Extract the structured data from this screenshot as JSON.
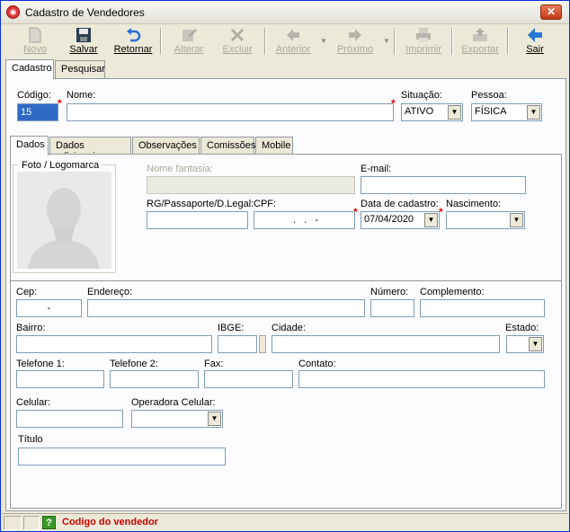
{
  "window": {
    "title": "Cadastro de Vendedores",
    "close_glyph": "✕"
  },
  "toolbar": {
    "novo": "Novo",
    "salvar": "Salvar",
    "retornar": "Retornar",
    "alterar": "Alterar",
    "excluir": "Excluir",
    "anterior": "Anterior",
    "proximo": "Próximo",
    "imprimir": "Imprimir",
    "exportar": "Exportar",
    "sair": "Sair"
  },
  "main_tabs": [
    "Cadastro",
    "Pesquisar"
  ],
  "header": {
    "codigo_label": "Código:",
    "codigo_value": "15",
    "nome_label": "Nome:",
    "nome_value": "",
    "situacao_label": "Situação:",
    "situacao_value": "ATIVO",
    "pessoa_label": "Pessoa:",
    "pessoa_value": "FÍSICA"
  },
  "sub_tabs": [
    "Dados",
    "Dados adicionais",
    "Observações",
    "Comissões",
    "Mobile"
  ],
  "dados": {
    "foto_label": "Foto / Logomarca",
    "nome_fantasia_label": "Nome fantasia:",
    "email_label": "E-mail:",
    "rg_label": "RG/Passaporte/D.Legal:",
    "cpf_label": "CPF:",
    "cpf_value": " .   .   -",
    "data_cadastro_label": "Data de cadastro:",
    "data_cadastro_value": "07/04/2020",
    "nascimento_label": "Nascimento:"
  },
  "endereco": {
    "cep_label": "Cep:",
    "cep_value": "-",
    "endereco_label": "Endereço:",
    "numero_label": "Número:",
    "complemento_label": "Complemento:",
    "bairro_label": "Bairro:",
    "ibge_label": "IBGE:",
    "cidade_label": "Cidade:",
    "estado_label": "Estado:",
    "telefone1_label": "Telefone 1:",
    "telefone2_label": "Telefone 2:",
    "fax_label": "Fax:",
    "contato_label": "Contato:",
    "celular_label": "Celular:",
    "operadora_label": "Operadora Celular:",
    "titulo_label": "Título"
  },
  "status": {
    "text": "Codigo do vendedor",
    "help_glyph": "?"
  },
  "icons": {
    "novo": "new-document-icon",
    "salvar": "floppy-disk-icon",
    "retornar": "undo-icon",
    "alterar": "edit-icon",
    "excluir": "delete-icon",
    "anterior": "arrow-left-icon",
    "proximo": "arrow-right-icon",
    "imprimir": "printer-icon",
    "exportar": "export-icon",
    "sair": "exit-arrow-icon"
  }
}
